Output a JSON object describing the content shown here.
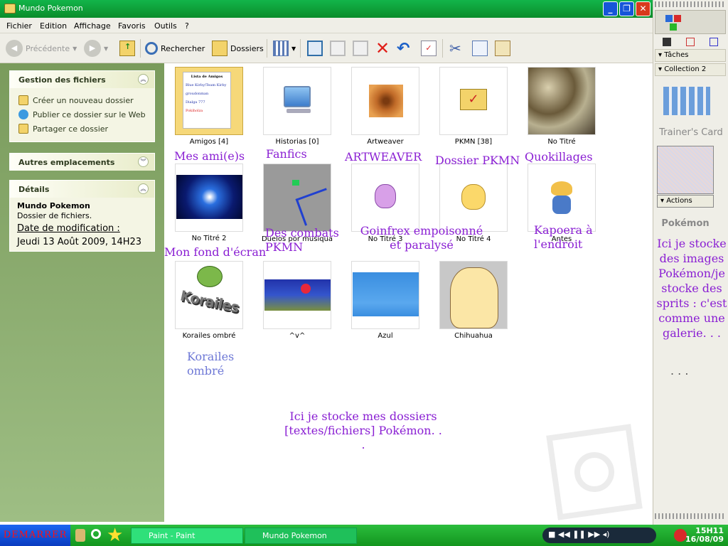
{
  "window": {
    "title": "Mundo Pokemon"
  },
  "menu": [
    "Fichier",
    "Edition",
    "Affichage",
    "Favoris",
    "Outils",
    "?"
  ],
  "toolbar": {
    "back": "Précédente",
    "search": "Rechercher",
    "folders": "Dossiers"
  },
  "left": {
    "file_tasks": {
      "title": "Gestion des fichiers",
      "items": [
        "Créer un nouveau dossier",
        "Publier ce dossier sur le Web",
        "Partager ce dossier"
      ]
    },
    "other_places": {
      "title": "Autres emplacements"
    },
    "details": {
      "title": "Détails",
      "name": "Mundo Pokemon",
      "type": "Dossier de fichiers.",
      "date_label": "Date de modification :",
      "date_value": "Jeudi 13 Août 2009, 14H23"
    }
  },
  "items": [
    {
      "caption": "Amigos [4]"
    },
    {
      "caption": "Historias [0]"
    },
    {
      "caption": "Artweaver"
    },
    {
      "caption": "PKMN [38]"
    },
    {
      "caption": "No Titré"
    },
    {
      "caption": "No Titré 2"
    },
    {
      "caption": "Duelos por musiqua"
    },
    {
      "caption": "No Titré 3"
    },
    {
      "caption": "No Titré 4"
    },
    {
      "caption": "Antes"
    },
    {
      "caption": "Korailes ombré"
    },
    {
      "caption": "^v^"
    },
    {
      "caption": "Azul"
    },
    {
      "caption": "Chihuahua"
    }
  ],
  "folder_paper": {
    "title": "Lista de Amigos",
    "line1": "Blue Kirby/Team Kirby",
    "line2": "groudonman",
    "line3": "Dialga 777",
    "line4": "Pokiholza"
  },
  "korailes_text": "Korailes",
  "annotations": {
    "a1": "Mes ami(e)s",
    "a2": "Fanfics",
    "a3": "ARTWEAVER",
    "a4": "Dossier PKMN",
    "a5": "Quokillages",
    "a6": "Mon fond d'écran",
    "a7": "Des combats PKMN",
    "a8": "Goinfrex empoisonné et paralysé",
    "a9": "Kapoera à l'endroit",
    "a10": "Korailes ombré",
    "bottom_note": "Ici je stocke mes dossiers [textes/fichiers] Pokémon. . .",
    "right_note": "Ici je stocke des images Pokémon/je stocke des sprits : c'est comme une galerie. . .",
    "dots": ". . ."
  },
  "right": {
    "taches": "Tâches",
    "collection": "Collection 2",
    "trainers_card": "Trainer's Card",
    "actions": "Actions",
    "pokemon": "Pokémon"
  },
  "taskbar": {
    "start": "DEMARRER",
    "btn1": "Paint - Paint",
    "btn2": "Mundo Pokemon",
    "time": "15H11",
    "date": "16/08/09"
  },
  "colors": {
    "title_green": "#0a8c2a",
    "annotation_purple": "#8a1fd3",
    "left_pane": "#8cae70",
    "taskbar_green": "#13951e"
  }
}
